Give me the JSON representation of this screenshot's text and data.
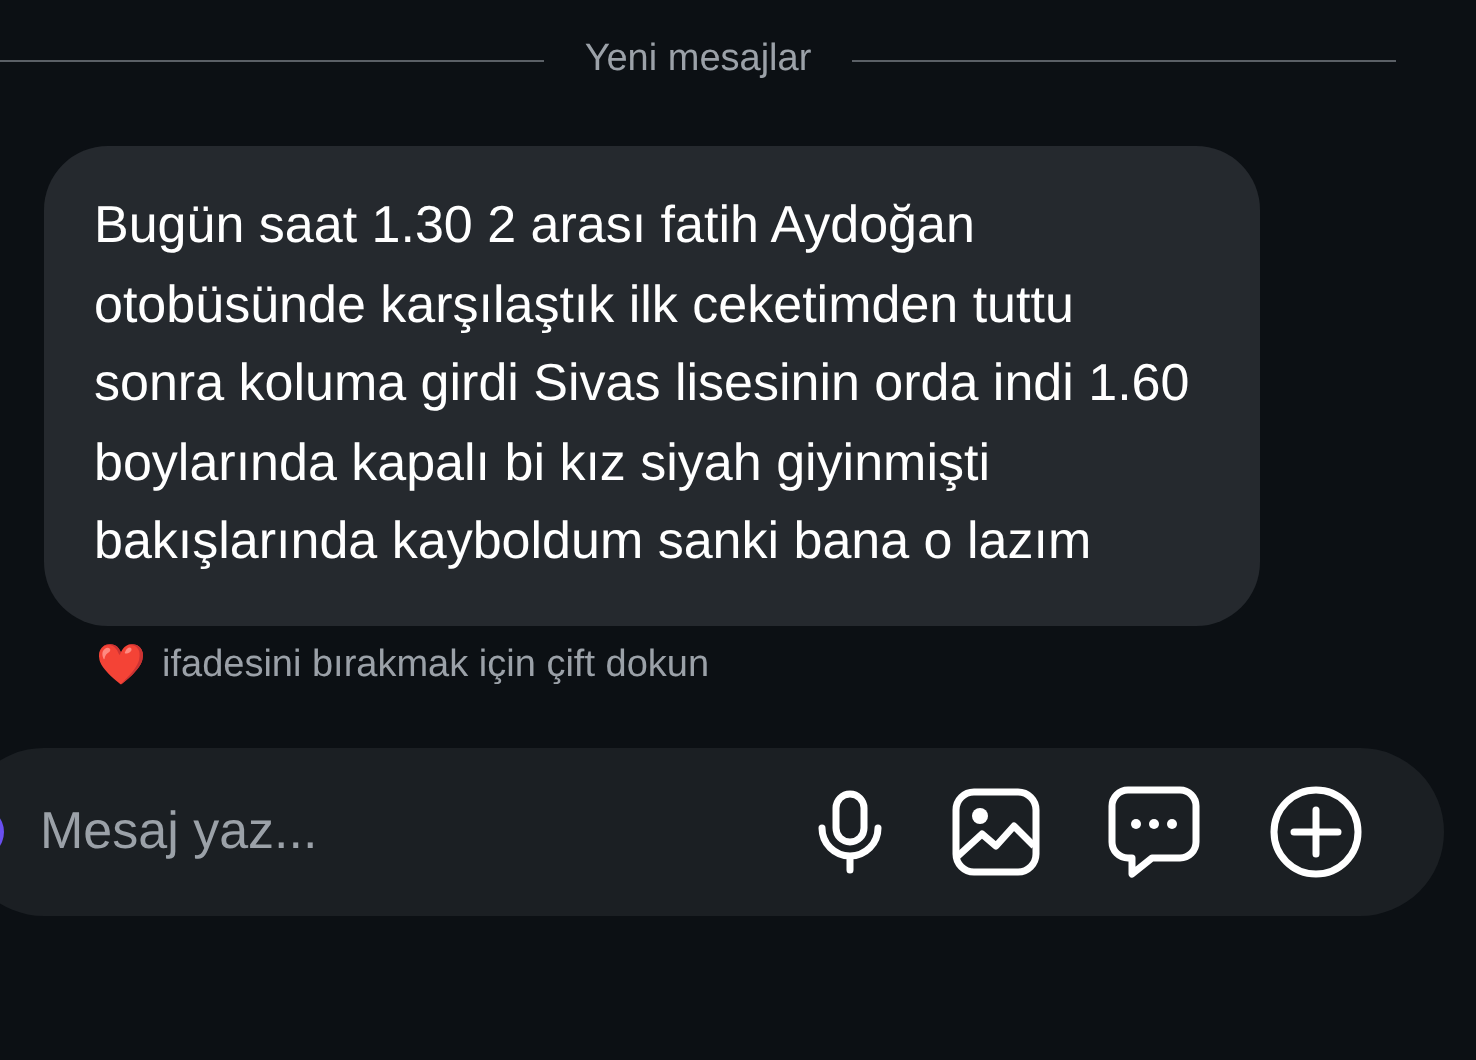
{
  "divider": {
    "label": "Yeni mesajlar"
  },
  "message": {
    "text": "Bugün saat 1.30 2 arası fatih Aydoğan otobüsünde karşılaştık ilk ceketimden tuttu sonra koluma girdi Sivas lisesinin orda indi 1.60 boylarında kapalı bi kız siyah giyinmişti bakışlarında kayboldum sanki bana o lazım"
  },
  "reaction_hint": {
    "emoji": "❤️",
    "text": "ifadesini bırakmak için çift dokun"
  },
  "composer": {
    "placeholder": "Mesaj yaz..."
  }
}
